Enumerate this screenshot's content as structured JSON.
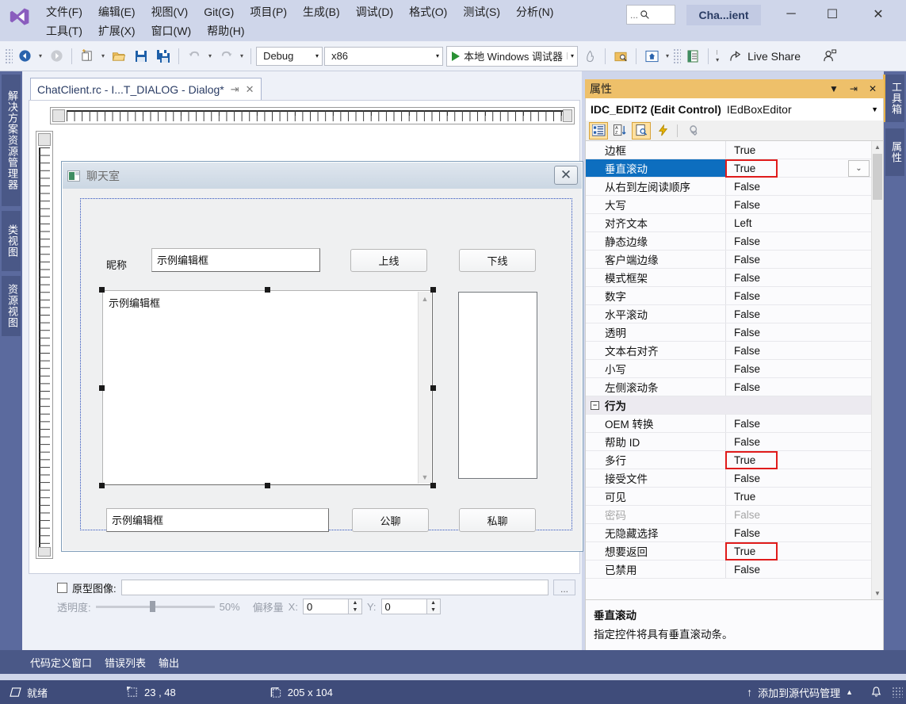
{
  "window": {
    "title": "Cha...ient",
    "minimize": "─",
    "maximize": "☐",
    "close": "✕",
    "search_placeholder": "..."
  },
  "menu": {
    "row1": [
      {
        "label": "文件(F)"
      },
      {
        "label": "编辑(E)"
      },
      {
        "label": "视图(V)"
      },
      {
        "label": "Git(G)"
      },
      {
        "label": "项目(P)"
      },
      {
        "label": "生成(B)"
      },
      {
        "label": "调试(D)"
      },
      {
        "label": "格式(O)"
      },
      {
        "label": "测试(S)"
      },
      {
        "label": "分析(N)"
      }
    ],
    "row2": [
      {
        "label": "工具(T)"
      },
      {
        "label": "扩展(X)"
      },
      {
        "label": "窗口(W)"
      },
      {
        "label": "帮助(H)"
      }
    ]
  },
  "toolbar": {
    "config": "Debug",
    "platform": "x86",
    "run_label": "本地 Windows 调试器",
    "live_share": "Live Share"
  },
  "left_dock": {
    "tabs": [
      "解决方案资源管理器",
      "类视图",
      "资源视图"
    ]
  },
  "right_dock": {
    "tabs": [
      "工具箱",
      "属性"
    ]
  },
  "document": {
    "tab_label": "ChatClient.rc - I...T_DIALOG - Dialog*",
    "pin_icon": "↵",
    "close_icon": "✕"
  },
  "dialog_preview": {
    "title": "聊天室",
    "close_glyph": "✕",
    "nickname_label": "昵称",
    "nickname_value": "示例编辑框",
    "btn_online": "上线",
    "btn_offline": "下线",
    "chat_log_value": "示例编辑框",
    "message_value": "示例编辑框",
    "btn_public": "公聊",
    "btn_private": "私聊"
  },
  "prototype_bar": {
    "checkbox_label": "原型图像:",
    "path_value": "",
    "browse_label": "...",
    "opacity_label": "透明度:",
    "opacity_value": "50%",
    "offset_label": "偏移量",
    "offset_x_label": "X:",
    "offset_x_value": "0",
    "offset_y_label": "Y:",
    "offset_y_value": "0"
  },
  "bottom_tabs": [
    "代码定义窗口",
    "错误列表",
    "输出"
  ],
  "statusbar": {
    "ready": "就绪",
    "position": "23 , 48",
    "size": "205 x 104",
    "source_control": "添加到源代码管理",
    "source_control_caret": "▲",
    "bell": "ὑ4"
  },
  "properties": {
    "panel_title": "属性",
    "dropdown_icon": "▼",
    "pin_icon": "↵",
    "close_icon": "✕",
    "object_name": "IDC_EDIT2 (Edit Control)",
    "object_editor": "IEdBoxEditor",
    "object_caret": "▼",
    "rows": [
      {
        "name": "边框",
        "value": "True",
        "kind": "normal"
      },
      {
        "name": "垂直滚动",
        "value": "True",
        "kind": "selected",
        "highlight": true,
        "dropdown": true
      },
      {
        "name": "从右到左阅读顺序",
        "value": "False",
        "kind": "normal"
      },
      {
        "name": "大写",
        "value": "False",
        "kind": "normal"
      },
      {
        "name": "对齐文本",
        "value": "Left",
        "kind": "normal"
      },
      {
        "name": "静态边缘",
        "value": "False",
        "kind": "normal"
      },
      {
        "name": "客户端边缘",
        "value": "False",
        "kind": "normal"
      },
      {
        "name": "模式框架",
        "value": "False",
        "kind": "normal"
      },
      {
        "name": "数字",
        "value": "False",
        "kind": "normal"
      },
      {
        "name": "水平滚动",
        "value": "False",
        "kind": "normal"
      },
      {
        "name": "透明",
        "value": "False",
        "kind": "normal"
      },
      {
        "name": "文本右对齐",
        "value": "False",
        "kind": "normal"
      },
      {
        "name": "小写",
        "value": "False",
        "kind": "normal"
      },
      {
        "name": "左侧滚动条",
        "value": "False",
        "kind": "normal"
      },
      {
        "name": "行为",
        "value": "",
        "kind": "category"
      },
      {
        "name": "OEM 转换",
        "value": "False",
        "kind": "normal"
      },
      {
        "name": "帮助 ID",
        "value": "False",
        "kind": "normal"
      },
      {
        "name": "多行",
        "value": "True",
        "kind": "normal",
        "highlight": true
      },
      {
        "name": "接受文件",
        "value": "False",
        "kind": "normal"
      },
      {
        "name": "可见",
        "value": "True",
        "kind": "normal"
      },
      {
        "name": "密码",
        "value": "False",
        "kind": "disabled"
      },
      {
        "name": "无隐藏选择",
        "value": "False",
        "kind": "normal"
      },
      {
        "name": "想要返回",
        "value": "True",
        "kind": "normal",
        "highlight": true
      },
      {
        "name": "已禁用",
        "value": "False",
        "kind": "normal"
      }
    ],
    "description_title": "垂直滚动",
    "description_text": "指定控件将具有垂直滚动条。"
  },
  "colors": {
    "accent_orange": "#eec06a",
    "selection_blue": "#0d6ebf",
    "highlight_red": "#e01b1b",
    "chrome_blue": "#cfd6ea",
    "dock_blue": "#5b6a9e",
    "status_blue": "#3f4c7a"
  }
}
